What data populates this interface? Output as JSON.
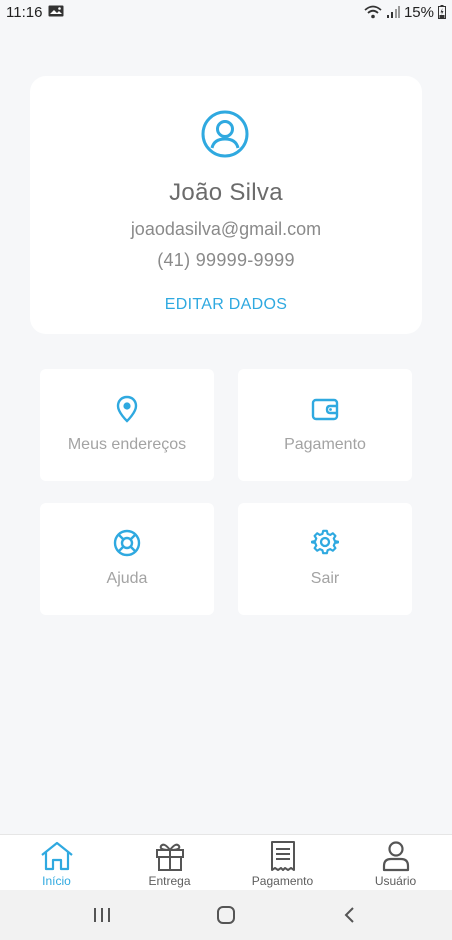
{
  "status_bar": {
    "time": "11:16",
    "battery": "15%"
  },
  "profile": {
    "name": "João Silva",
    "email": "joaodasilva@gmail.com",
    "phone": "(41) 99999-9999",
    "edit_label": "EDITAR DADOS"
  },
  "tiles": [
    {
      "label": "Meus endereços",
      "icon": "location-pin-icon"
    },
    {
      "label": "Pagamento",
      "icon": "wallet-icon"
    },
    {
      "label": "Ajuda",
      "icon": "lifebuoy-icon"
    },
    {
      "label": "Sair",
      "icon": "gear-icon"
    }
  ],
  "bottom_nav": {
    "active_index": 0,
    "items": [
      {
        "label": "Início",
        "icon": "home-icon"
      },
      {
        "label": "Entrega",
        "icon": "gift-icon"
      },
      {
        "label": "Pagamento",
        "icon": "receipt-icon"
      },
      {
        "label": "Usuário",
        "icon": "user-icon"
      }
    ]
  },
  "colors": {
    "accent": "#2fa9e0",
    "background": "#f6f7f9",
    "card": "#ffffff",
    "muted_text": "#a3a3a3"
  }
}
